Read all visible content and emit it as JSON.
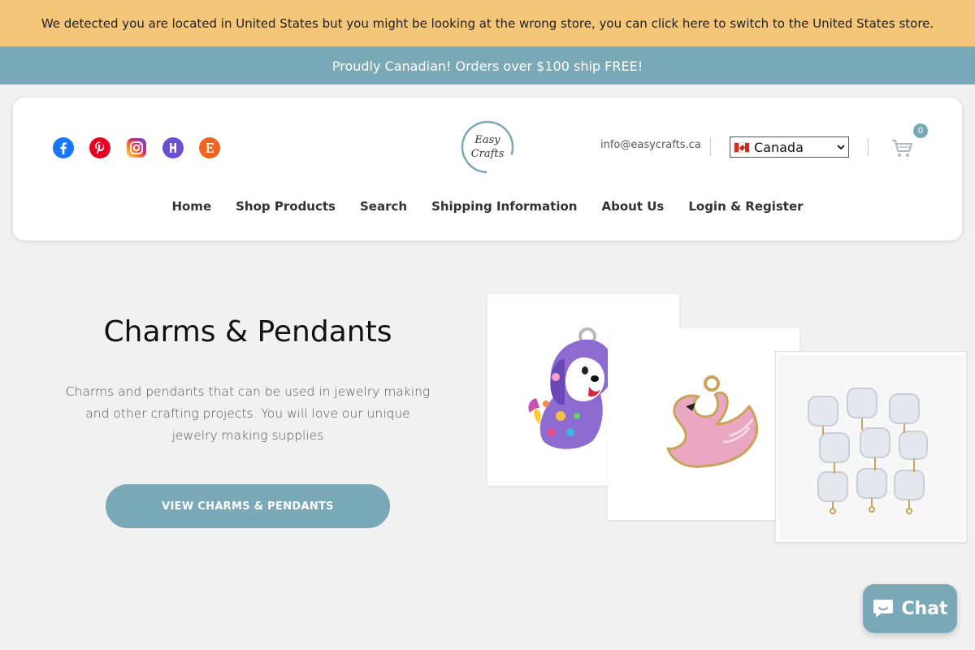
{
  "geo_banner": {
    "text": "We detected you are located in United States but you might be looking at the wrong store, you can click here to switch to the United States store."
  },
  "announcement": {
    "text": "Proudly Canadian! Orders over $100 ship FREE!"
  },
  "header": {
    "logo_text_line1": "Easy",
    "logo_text_line2": "Crafts",
    "email": "info@easycrafts.ca",
    "country_selector": {
      "selected": "Canada"
    },
    "cart_count": "0",
    "social_icons": [
      "facebook-icon",
      "pinterest-icon",
      "instagram-icon",
      "houzz-icon",
      "etsy-icon"
    ]
  },
  "nav": {
    "items": [
      "Home",
      "Shop Products",
      "Search",
      "Shipping Information",
      "About Us",
      "Login & Register"
    ]
  },
  "hero": {
    "title": "Charms & Pendants",
    "description": "Charms and pendants that can be used in jewelry making and other crafting projects. You will love our unique jewelry making supplies",
    "button_label": "VIEW CHARMS & PENDANTS"
  },
  "chat": {
    "label": "Chat"
  },
  "colors": {
    "accent": "#79a8b6",
    "geo_banner_bg": "#f3c67a",
    "page_bg": "#f1f1f1"
  }
}
